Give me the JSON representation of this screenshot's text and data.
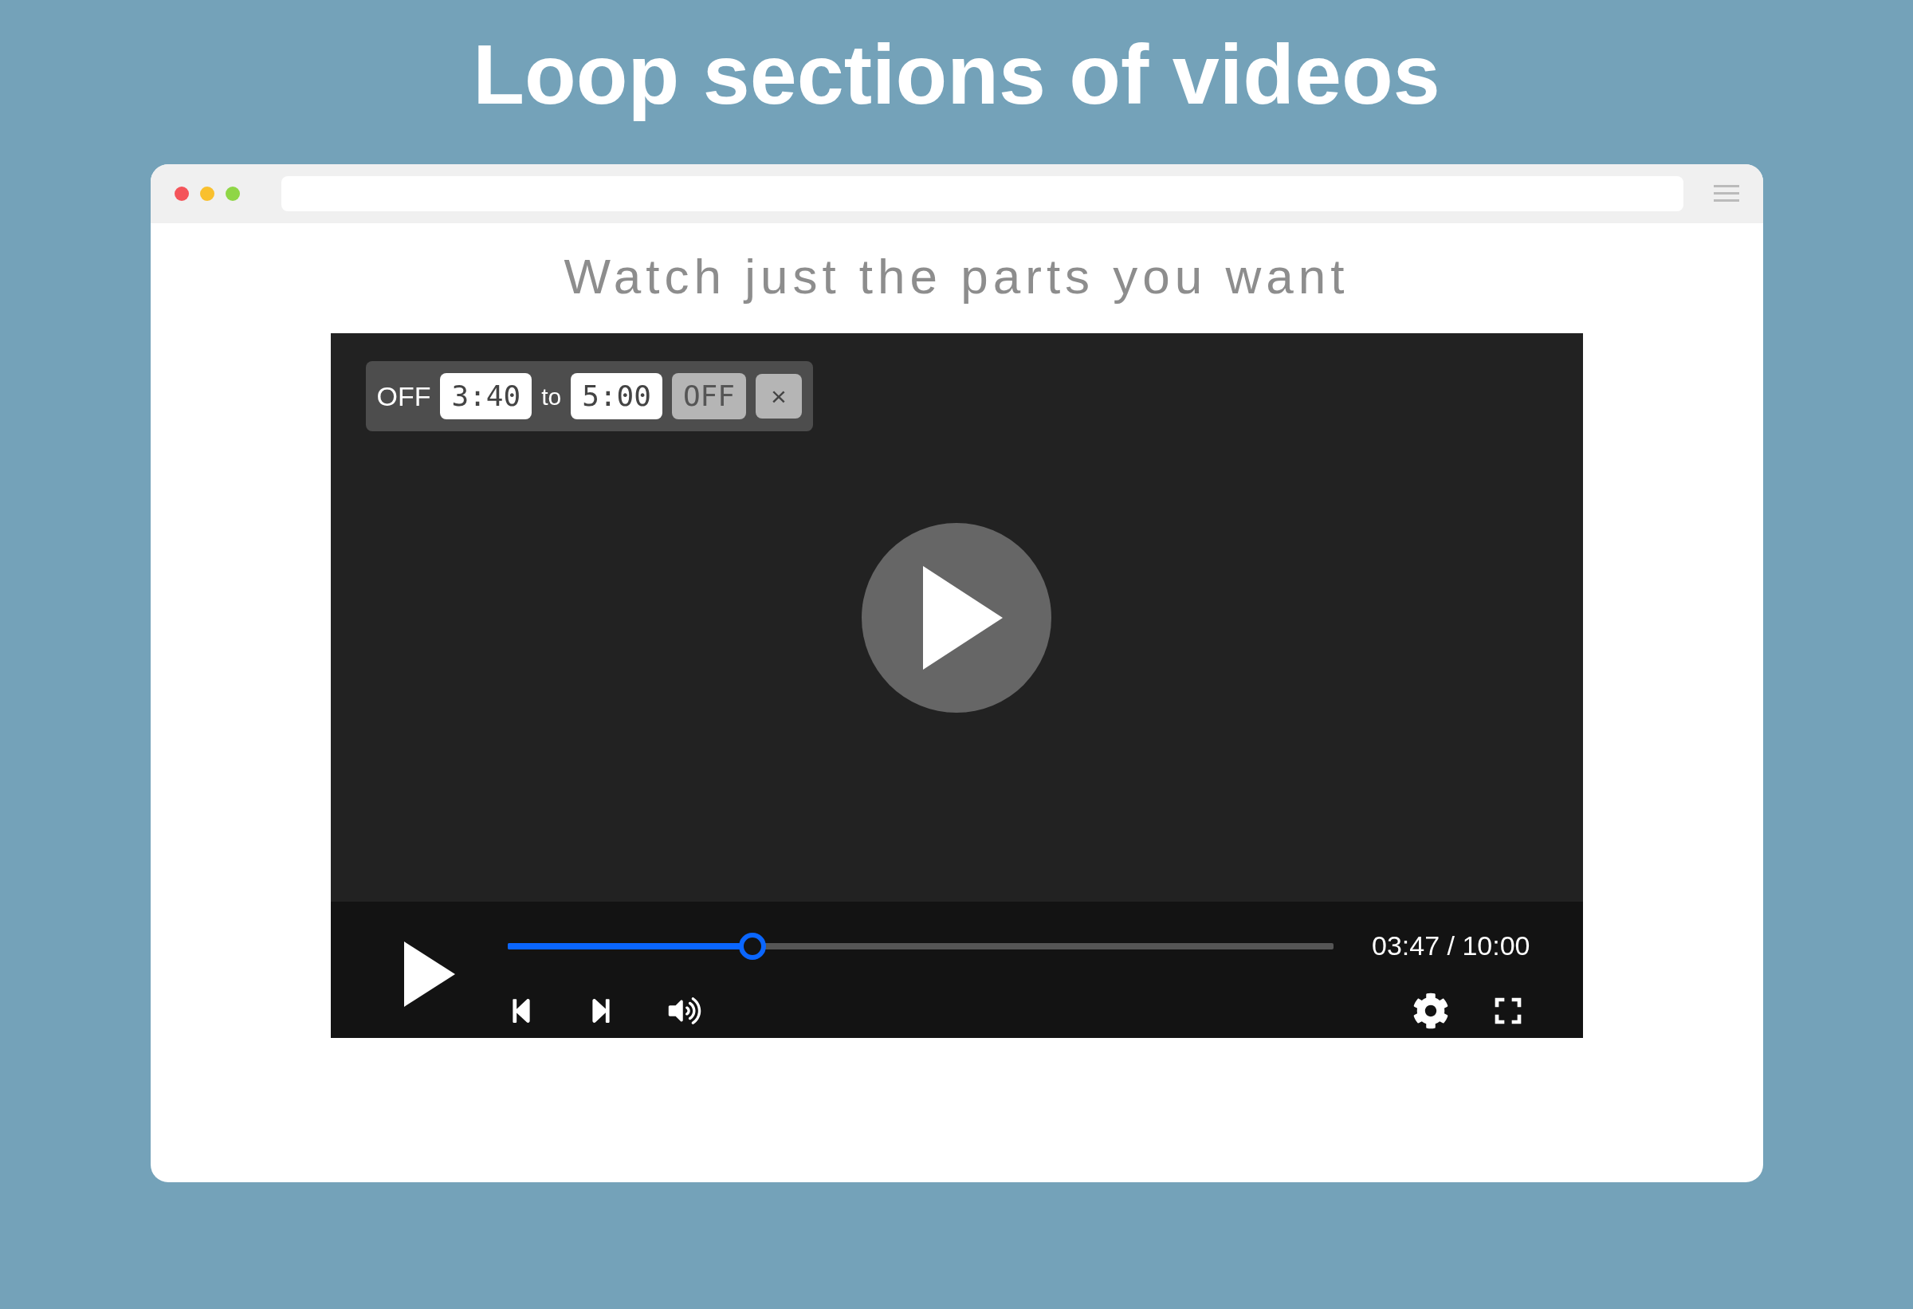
{
  "heading": "Loop sections of videos",
  "page": {
    "subtitle": "Watch just the parts you want"
  },
  "loop_bar": {
    "status": "OFF",
    "start": "3:40",
    "separator": "to",
    "end": "5:00",
    "toggle": "OFF",
    "close": "×"
  },
  "player": {
    "progress": {
      "level": 0.297
    },
    "time": "03:47 / 10:00"
  }
}
